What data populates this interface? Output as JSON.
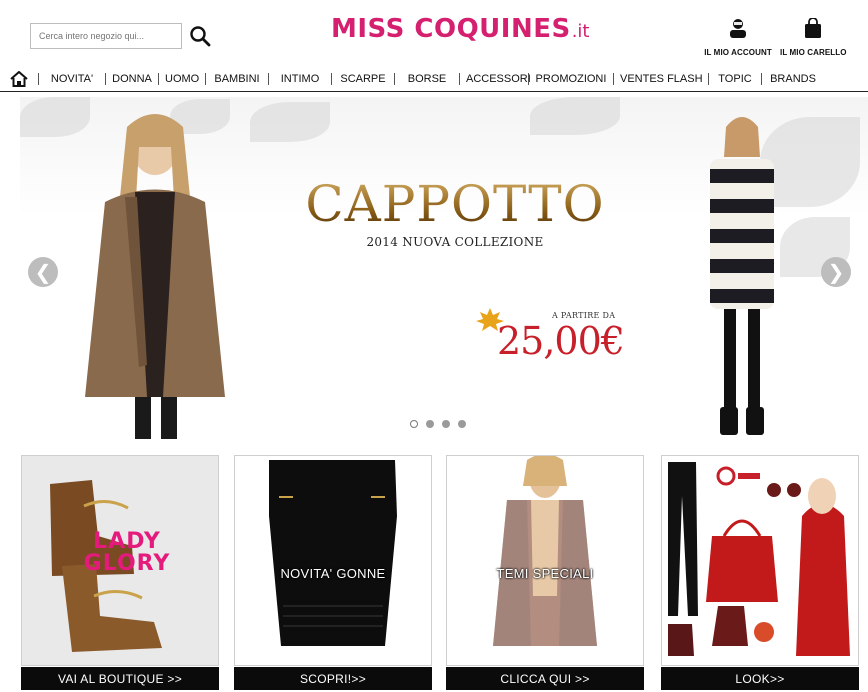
{
  "header": {
    "search": {
      "placeholder": "Cerca intero negozio qui..."
    },
    "logo": {
      "main": "MISS COQUINES",
      "tld": ".it"
    },
    "account_label": "IL MIO ACCOUNT",
    "cart_label": "IL MIO CARELLO"
  },
  "nav": {
    "items": [
      {
        "label": "NOVITA'"
      },
      {
        "label": "DONNA"
      },
      {
        "label": "UOMO"
      },
      {
        "label": "BAMBINI"
      },
      {
        "label": "INTIMO"
      },
      {
        "label": "SCARPE"
      },
      {
        "label": "BORSE"
      },
      {
        "label": "ACCESSORI"
      },
      {
        "label": "PROMOZIONI"
      },
      {
        "label": "VENTES FLASH"
      },
      {
        "label": "TOPIC"
      },
      {
        "label": "BRANDS"
      }
    ]
  },
  "banner": {
    "title": "CAPPOTTO",
    "subtitle": "2014 NUOVA COLLEZIONE",
    "price_prefix": "A PARTIRE DA",
    "price": "25,00€",
    "prev_symbol": "❮",
    "next_symbol": "❯",
    "slides_total": 4,
    "active_slide": 1
  },
  "tiles": [
    {
      "overlay_line1": "LADY",
      "overlay_line2": "GLORY",
      "cta": "VAI AL BOUTIQUE >>"
    },
    {
      "overlay": "NOVITA' GONNE",
      "cta": "SCOPRI!>>"
    },
    {
      "overlay": "TEMI   SPECIALI",
      "cta": "CLICCA QUI >>"
    },
    {
      "cta": "LOOK>>"
    }
  ],
  "colors": {
    "brand": "#d4206e",
    "price_red": "#c8202a",
    "title_gold": "#b58a2e",
    "cta_bg": "#0b0b0b"
  },
  "icons": {
    "search": "search-icon",
    "account": "user-icon",
    "cart": "shopping-bag-icon",
    "home": "home-icon"
  }
}
